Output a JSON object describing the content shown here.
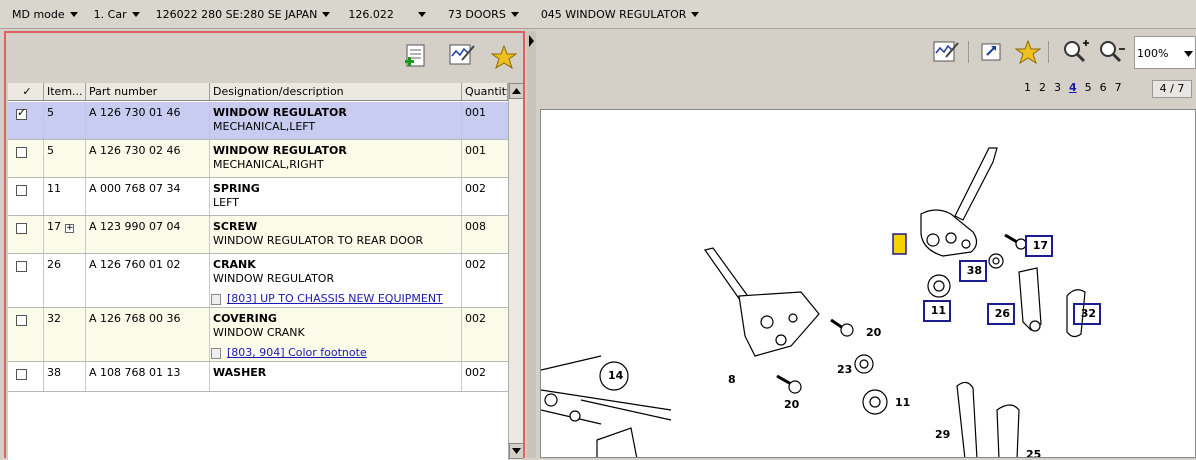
{
  "topbar": {
    "items": [
      {
        "label": "MD mode"
      },
      {
        "label": "1. Car"
      },
      {
        "label": "126022 280 SE:280 SE JAPAN"
      },
      {
        "label": "126.022"
      },
      {
        "label": "73 DOORS"
      },
      {
        "label": "045 WINDOW REGULATOR"
      }
    ]
  },
  "grid": {
    "headers": {
      "check": "✓",
      "item": "Item...",
      "part": "Part number",
      "desc": "Designation/description",
      "qty": "Quantity"
    },
    "rows": [
      {
        "item": "5",
        "part": "A 126 730 01 46",
        "name": "WINDOW REGULATOR",
        "sub": "MECHANICAL,LEFT",
        "qty": "001",
        "checked": true
      },
      {
        "item": "5",
        "part": "A 126 730 02 46",
        "name": "WINDOW REGULATOR",
        "sub": "MECHANICAL,RIGHT",
        "qty": "001"
      },
      {
        "item": "11",
        "part": "A 000 768 07 34",
        "name": "SPRING",
        "sub": "LEFT",
        "qty": "002"
      },
      {
        "item": "17",
        "part": "A 123 990 07 04",
        "name": "SCREW",
        "sub": "WINDOW REGULATOR TO REAR DOOR",
        "qty": "008",
        "plus": "+"
      },
      {
        "item": "26",
        "part": "A 126 760 01 02",
        "name": "CRANK",
        "sub": "WINDOW REGULATOR",
        "qty": "002",
        "footnote": "[803] UP TO CHASSIS NEW EQUIPMENT"
      },
      {
        "item": "32",
        "part": "A 126 768 00 36",
        "name": "COVERING",
        "sub": "WINDOW CRANK",
        "qty": "002",
        "footnote": "[803, 904] Color footnote"
      },
      {
        "item": "38",
        "part": "A 108 768 01 13",
        "name": "WASHER",
        "sub": "",
        "qty": "002"
      }
    ]
  },
  "viewer": {
    "zoom": "100%",
    "pages": [
      "1",
      "2",
      "3",
      "4",
      "5",
      "6",
      "7"
    ],
    "current_page": "4",
    "page_indicator": "4 / 7",
    "callouts": [
      "17",
      "38",
      "11",
      "26",
      "32"
    ],
    "labels": [
      "20",
      "14",
      "23",
      "11",
      "8",
      "20",
      "29",
      "25"
    ]
  },
  "colors": {
    "selected_row": "#c8ccf0",
    "alt_row": "#fbfbe9",
    "callout_border": "#1c1c90",
    "highlight": "#f5d300"
  }
}
